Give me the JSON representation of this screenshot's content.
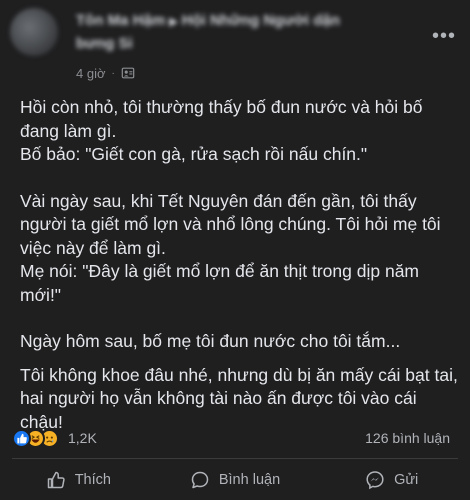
{
  "post": {
    "author": "Tôn Ma Hậm",
    "group": "Hội Những Người dận bưng Si",
    "time": "4 giờ",
    "separator": "·",
    "paragraphs": [
      "Hồi còn nhỏ, tôi thường thấy bố đun nước và hỏi bố đang làm gì.",
      "Bố bảo: \"Giết con gà, rửa sạch rồi nấu chín.\"",
      "Vài ngày sau, khi Tết Nguyên đán đến gần, tôi thấy người ta giết mổ lợn và nhổ lông chúng. Tôi hỏi mẹ tôi việc này để làm gì.",
      "Mẹ nói: \"Đây là giết mổ lợn để ăn thịt trong dịp năm mới!\"",
      "Ngày hôm sau, bố mẹ tôi đun nước cho tôi tắm...",
      "Tôi không khoe đâu nhé, nhưng dù bị ăn mấy cái bạt tai, hai người họ vẫn không tài nào ấn được tôi vào cái chậu!"
    ]
  },
  "engagement": {
    "reaction_count": "1,2K",
    "comment_count": "126 bình luận",
    "reaction_icons": [
      "like-icon",
      "haha-icon",
      "sad-icon"
    ]
  },
  "actions": {
    "like": "Thích",
    "comment": "Bình luận",
    "send": "Gửi"
  },
  "colors": {
    "background": "#1f1f20",
    "text": "#e4e6eb",
    "secondary": "#b0b3b8",
    "like_blue": "#1877f2",
    "emoji_yellow": "#f7b125"
  }
}
